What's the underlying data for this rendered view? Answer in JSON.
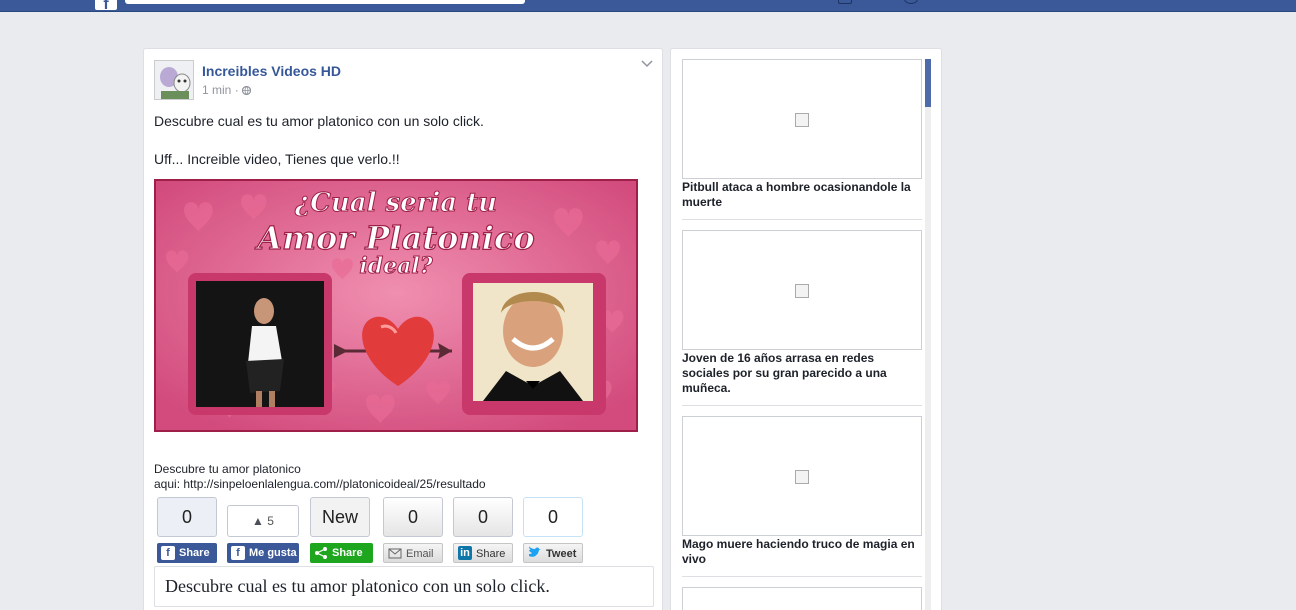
{
  "topbar": {
    "logo_glyph": "f",
    "brand_color": "#3b5998",
    "icons": [
      "messages-icon",
      "notifications-icon"
    ]
  },
  "post": {
    "page_name": "Increibles Videos HD",
    "timestamp": "1 min",
    "meta_separator": "·",
    "privacy_icon": "globe-icon",
    "text_line1": "Descubre cual es tu amor platonico con un solo click.",
    "text_line2": "Uff... Increible video, Tienes que verlo.!!",
    "image": {
      "title_line1": "¿Cual seria tu",
      "title_line2": "Amor Platonico",
      "title_line3": "ideal?"
    },
    "link_desc_line1": "Descubre tu amor platonico",
    "link_desc_line2": "aqui: http://sinpeloenlalengua.com//platonicoideal/25/resultado",
    "share_bar": [
      {
        "counter": "0",
        "label": "Share",
        "icon": "facebook-icon",
        "color": "#3b5998"
      },
      {
        "counter": "5",
        "label": "Me gusta",
        "icon": "facebook-icon",
        "color": "#3b5998"
      },
      {
        "counter": "New",
        "label": "Share",
        "icon": "share-icon",
        "color": "#1ea61e"
      },
      {
        "counter": "0",
        "label": "Email",
        "icon": "email-icon",
        "color": "#e9e9e9"
      },
      {
        "counter": "0",
        "label": "Share",
        "icon": "linkedin-icon",
        "color": "#e9e9e9"
      },
      {
        "counter": "0",
        "label": "Tweet",
        "icon": "twitter-icon",
        "color": "#e9e9e9"
      }
    ],
    "quote": "Descubre cual es tu amor platonico con un solo click."
  },
  "sidebar": {
    "items": [
      {
        "title": "Pitbull ataca a hombre ocasionandole la muerte"
      },
      {
        "title": "Joven de 16 años arrasa en redes sociales por su gran parecido a una muñeca."
      },
      {
        "title": "Mago muere haciendo truco de magia en vivo"
      }
    ]
  }
}
